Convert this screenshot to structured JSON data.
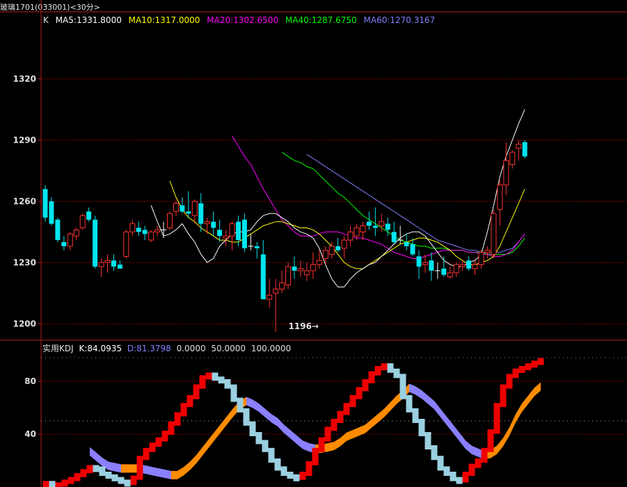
{
  "title": "玻璃1701(033001)<30分>",
  "legend": {
    "k_label": "K",
    "ma5": "MA5:1331.8000",
    "ma10": "MA10:1317.0000",
    "ma20": "MA20:1302.6500",
    "ma40": "MA40:1287.6750",
    "ma60": "MA60:1270.3167"
  },
  "kdj_legend": {
    "name": "实用KDJ",
    "k": "K:84.0935",
    "d": "D:81.3798",
    "v0": "0.0000",
    "v50": "50.0000",
    "v100": "100.0000"
  },
  "colors": {
    "up": "#ff3232",
    "down": "#00e5ee",
    "doji": "#ffffff",
    "ma5": "#ffffff",
    "ma10": "#ffff00",
    "ma20": "#ff00ff",
    "ma40": "#00ff00",
    "ma60": "#8080ff",
    "k_up": "#ee0000",
    "k_down": "#9ad0e0",
    "d_up": "#ff8c00",
    "d_down": "#8a80ff",
    "grid": "#8b0000",
    "frame": "#b22222"
  },
  "chart_data": [
    {
      "type": "candlestick",
      "yticks": [
        1200,
        1230,
        1260,
        1290,
        1320
      ],
      "ylim": [
        1195,
        1345
      ],
      "annotation": {
        "label": "1196",
        "arrow": "→",
        "value": 1196
      },
      "candles": [
        [
          1266,
          1268,
          1250,
          1252
        ],
        [
          1260,
          1262,
          1248,
          1249
        ],
        [
          1251,
          1252,
          1240,
          1241
        ],
        [
          1240,
          1243,
          1236,
          1238
        ],
        [
          1238,
          1245,
          1236,
          1244
        ],
        [
          1243,
          1247,
          1241,
          1246
        ],
        [
          1247,
          1254,
          1246,
          1253
        ],
        [
          1255,
          1257,
          1250,
          1251
        ],
        [
          1251,
          1253,
          1227,
          1228
        ],
        [
          1228,
          1232,
          1223,
          1230
        ],
        [
          1230,
          1234,
          1225,
          1231
        ],
        [
          1231,
          1234,
          1226,
          1228
        ],
        [
          1229,
          1231,
          1227,
          1227
        ],
        [
          1233,
          1246,
          1232,
          1245
        ],
        [
          1245,
          1251,
          1243,
          1249
        ],
        [
          1247,
          1250,
          1243,
          1245
        ],
        [
          1246,
          1248,
          1241,
          1244
        ],
        [
          1241,
          1246,
          1240,
          1245
        ],
        [
          1245,
          1248,
          1243,
          1246
        ],
        [
          1246,
          1250,
          1242,
          1246
        ],
        [
          1247,
          1255,
          1246,
          1254
        ],
        [
          1255,
          1260,
          1253,
          1259
        ],
        [
          1258,
          1262,
          1254,
          1255
        ],
        [
          1255,
          1265,
          1252,
          1254
        ],
        [
          1253,
          1261,
          1249,
          1260
        ],
        [
          1259,
          1264,
          1245,
          1249
        ],
        [
          1249,
          1252,
          1244,
          1250
        ],
        [
          1250,
          1255,
          1243,
          1247
        ],
        [
          1246,
          1251,
          1240,
          1243
        ],
        [
          1242,
          1246,
          1238,
          1243
        ],
        [
          1243,
          1250,
          1236,
          1249
        ],
        [
          1250,
          1253,
          1238,
          1241
        ],
        [
          1251,
          1254,
          1235,
          1237
        ],
        [
          1238,
          1244,
          1236,
          1238
        ],
        [
          1238,
          1240,
          1232,
          1237
        ],
        [
          1234,
          1241,
          1216,
          1212
        ],
        [
          1212,
          1222,
          1208,
          1214
        ],
        [
          1215,
          1222,
          1196,
          1217
        ],
        [
          1217,
          1226,
          1215,
          1220
        ],
        [
          1219,
          1230,
          1217,
          1228
        ],
        [
          1228,
          1233,
          1222,
          1226
        ],
        [
          1226,
          1231,
          1223,
          1227
        ],
        [
          1224,
          1230,
          1221,
          1226
        ],
        [
          1226,
          1235,
          1222,
          1229
        ],
        [
          1229,
          1236,
          1227,
          1231
        ],
        [
          1232,
          1238,
          1229,
          1236
        ],
        [
          1234,
          1240,
          1232,
          1238
        ],
        [
          1238,
          1242,
          1235,
          1236
        ],
        [
          1237,
          1243,
          1232,
          1241
        ],
        [
          1241,
          1248,
          1238,
          1245
        ],
        [
          1243,
          1249,
          1241,
          1247
        ],
        [
          1245,
          1250,
          1241,
          1248
        ],
        [
          1250,
          1255,
          1246,
          1248
        ],
        [
          1248,
          1257,
          1243,
          1247
        ],
        [
          1248,
          1254,
          1245,
          1250
        ],
        [
          1249,
          1252,
          1243,
          1246
        ],
        [
          1245,
          1250,
          1239,
          1240
        ],
        [
          1241,
          1248,
          1239,
          1241
        ],
        [
          1240,
          1244,
          1236,
          1238
        ],
        [
          1239,
          1242,
          1233,
          1234
        ],
        [
          1233,
          1236,
          1222,
          1228
        ],
        [
          1229,
          1234,
          1225,
          1230
        ],
        [
          1231,
          1235,
          1221,
          1226
        ],
        [
          1226,
          1230,
          1222,
          1226
        ],
        [
          1227,
          1233,
          1223,
          1224
        ],
        [
          1223,
          1228,
          1222,
          1225
        ],
        [
          1225,
          1230,
          1223,
          1229
        ],
        [
          1228,
          1231,
          1226,
          1229
        ],
        [
          1231,
          1233,
          1226,
          1227
        ],
        [
          1227,
          1231,
          1224,
          1229
        ],
        [
          1229,
          1236,
          1227,
          1235
        ],
        [
          1235,
          1238,
          1232,
          1236
        ],
        [
          1234,
          1256,
          1232,
          1254
        ],
        [
          1256,
          1270,
          1248,
          1268
        ],
        [
          1268,
          1289,
          1263,
          1280
        ],
        [
          1278,
          1285,
          1276,
          1284
        ],
        [
          1286,
          1290,
          1280,
          1288
        ],
        [
          1289,
          1290,
          1281,
          1282
        ]
      ],
      "ma5": [
        1258,
        1250,
        1243,
        1244,
        1246,
        1249,
        1244,
        1240,
        1234,
        1230,
        1232,
        1238,
        1241,
        1244,
        1245,
        1245,
        1246,
        1250,
        1253,
        1254,
        1254,
        1252,
        1250,
        1247,
        1245,
        1244,
        1242,
        1237,
        1229,
        1222,
        1218,
        1218,
        1222,
        1225,
        1227,
        1229,
        1230,
        1233,
        1236,
        1239,
        1242,
        1244,
        1245,
        1245,
        1243,
        1239,
        1235,
        1231,
        1229,
        1228,
        1228,
        1230,
        1231,
        1234,
        1245,
        1258,
        1272,
        1282,
        1290,
        1298,
        1305
      ],
      "ma10": [
        1270,
        1262,
        1256,
        1252,
        1250,
        1247,
        1245,
        1243,
        1241,
        1241,
        1240,
        1240,
        1242,
        1244,
        1246,
        1248,
        1249,
        1250,
        1250,
        1249,
        1248,
        1247,
        1247,
        1246,
        1244,
        1241,
        1238,
        1234,
        1230,
        1228,
        1227,
        1227,
        1229,
        1231,
        1233,
        1235,
        1237,
        1239,
        1240,
        1241,
        1242,
        1242,
        1241,
        1240,
        1238,
        1236,
        1233,
        1231,
        1229,
        1229,
        1230,
        1231,
        1233,
        1238,
        1245,
        1252,
        1259,
        1266
      ],
      "ma20": [
        1292,
        1287,
        1282,
        1278,
        1272,
        1266,
        1261,
        1256,
        1251,
        1248,
        1245,
        1243,
        1243,
        1243,
        1244,
        1245,
        1245,
        1245,
        1244,
        1243,
        1242,
        1242,
        1241,
        1240,
        1239,
        1237,
        1235,
        1234,
        1233,
        1232,
        1232,
        1233,
        1234,
        1235,
        1236,
        1236,
        1236,
        1236,
        1235,
        1235,
        1234,
        1234,
        1233,
        1233,
        1234,
        1236,
        1240,
        1244
      ],
      "ma40": [
        1284,
        1282,
        1280,
        1279,
        1277,
        1276,
        1273,
        1270,
        1267,
        1264,
        1262,
        1259,
        1256,
        1253,
        1251,
        1249,
        1247,
        1245,
        1243,
        1241,
        1240,
        1239,
        1238,
        1238,
        1237,
        1237,
        1237,
        1236,
        1236,
        1236,
        1235,
        1235,
        1235,
        1234,
        1234,
        1234,
        1234,
        1235,
        1238,
        1242
      ],
      "ma60": [
        1283,
        1281,
        1279,
        1277,
        1275,
        1273,
        1271,
        1269,
        1267,
        1265,
        1263,
        1261,
        1259,
        1257,
        1255,
        1253,
        1251,
        1249,
        1247,
        1245,
        1243,
        1241,
        1240,
        1239,
        1238,
        1237,
        1236,
        1236,
        1235,
        1235,
        1235,
        1235,
        1236,
        1237,
        1240,
        1244
      ]
    },
    {
      "type": "kdj",
      "yticks": [
        40,
        80
      ],
      "ylim": [
        0,
        100
      ],
      "reference_lines": [
        0,
        50,
        100
      ],
      "k": [
        3,
        2,
        2,
        4,
        6,
        9,
        12,
        15,
        14,
        10,
        8,
        6,
        4,
        3,
        7,
        22,
        28,
        32,
        36,
        41,
        48,
        55,
        62,
        68,
        76,
        83,
        85,
        82,
        80,
        76,
        66,
        58,
        48,
        40,
        34,
        28,
        20,
        14,
        10,
        8,
        7,
        10,
        18,
        28,
        36,
        44,
        50,
        56,
        62,
        68,
        74,
        80,
        86,
        90,
        92,
        88,
        84,
        68,
        58,
        50,
        40,
        30,
        22,
        14,
        10,
        6,
        5,
        10,
        16,
        20,
        28,
        42,
        62,
        76,
        84,
        88,
        90,
        92,
        94,
        96
      ],
      "d": [
        27,
        23,
        19,
        16,
        15,
        14,
        14,
        14,
        14,
        13,
        12,
        11,
        10,
        9,
        9,
        12,
        16,
        21,
        27,
        33,
        39,
        45,
        51,
        57,
        62,
        65,
        63,
        60,
        56,
        52,
        49,
        44,
        40,
        36,
        32,
        30,
        29,
        29,
        30,
        31,
        34,
        38,
        40,
        42,
        44,
        48,
        52,
        56,
        61,
        66,
        70,
        75,
        73,
        70,
        66,
        62,
        56,
        50,
        44,
        38,
        32,
        28,
        26,
        24,
        25,
        28,
        34,
        42,
        52,
        60,
        66,
        72,
        76
      ]
    }
  ]
}
